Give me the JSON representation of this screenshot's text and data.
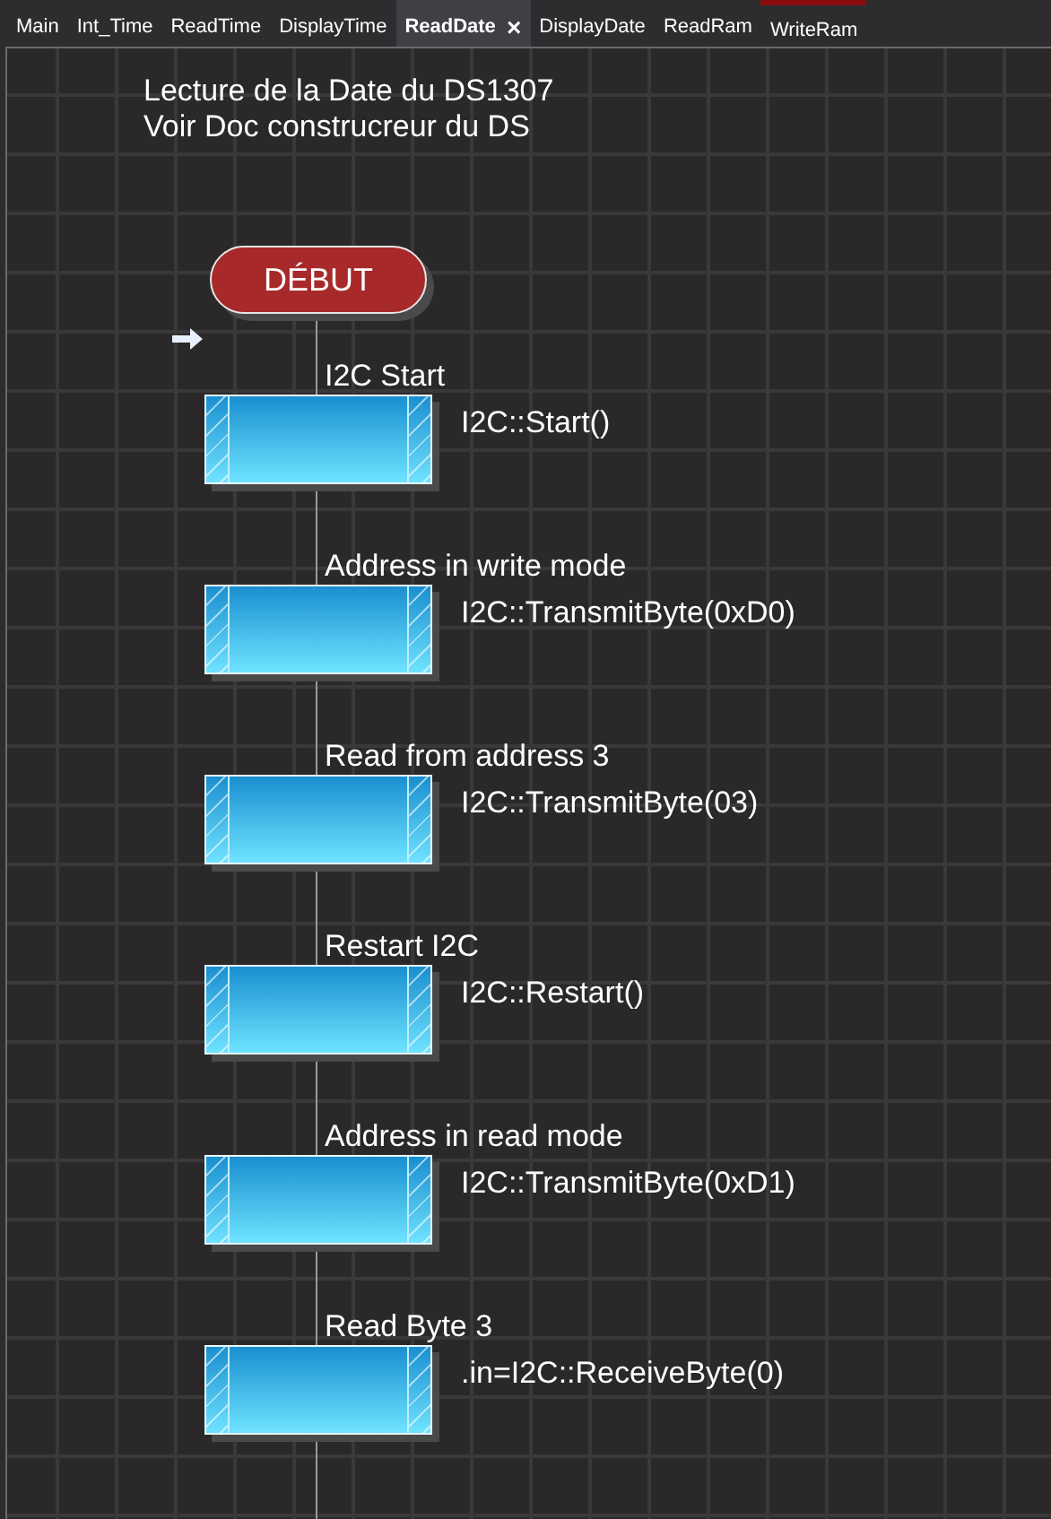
{
  "tabs": [
    {
      "label": "Main",
      "selected": false,
      "marked": false
    },
    {
      "label": "Int_Time",
      "selected": false,
      "marked": false
    },
    {
      "label": "ReadTime",
      "selected": false,
      "marked": false
    },
    {
      "label": "DisplayTime",
      "selected": false,
      "marked": false
    },
    {
      "label": "ReadDate",
      "selected": true,
      "marked": false,
      "close": "×"
    },
    {
      "label": "DisplayDate",
      "selected": false,
      "marked": false
    },
    {
      "label": "ReadRam",
      "selected": false,
      "marked": false
    },
    {
      "label": "WriteRam",
      "selected": false,
      "marked": true
    }
  ],
  "comment": [
    "Lecture de la Date du DS1307",
    "Voir Doc construcreur du DS"
  ],
  "start": {
    "label": "DÉBUT"
  },
  "steps": [
    {
      "label": "I2C Start",
      "code": "I2C::Start()"
    },
    {
      "label": "Address in write mode",
      "code": "I2C::TransmitByte(0xD0)"
    },
    {
      "label": "Read from address 3",
      "code": "I2C::TransmitByte(03)"
    },
    {
      "label": "Restart I2C",
      "code": "I2C::Restart()"
    },
    {
      "label": "Address in read mode",
      "code": "I2C::TransmitByte(0xD1)"
    },
    {
      "label": "Read Byte 3",
      "code": ".in=I2C::ReceiveByte(0)"
    }
  ]
}
